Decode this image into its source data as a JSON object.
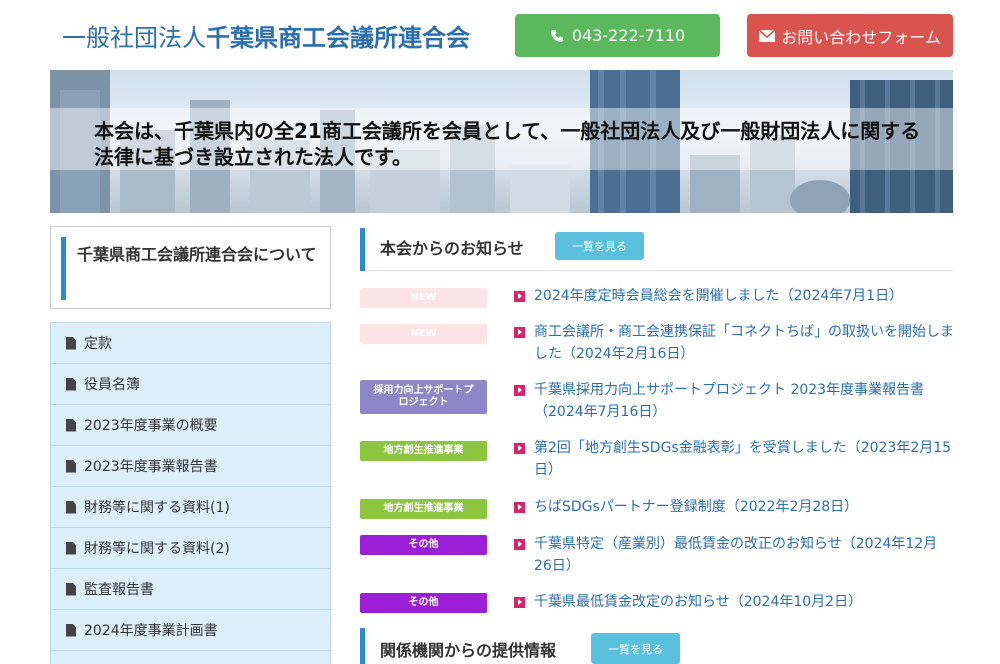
{
  "header": {
    "title_prefix": "一般社団法人",
    "title_main": "千葉県商工会議所連合会",
    "phone_label": "043-222-7110",
    "contact_label": "お問い合わせフォーム"
  },
  "hero": {
    "text": "本会は、千葉県内の全21商工会議所を会員として、一般社団法人及び一般財団法人に関する法律に基づき設立された法人です。"
  },
  "sidebar": {
    "heading": "千葉県商工会議所連合会について",
    "items": [
      "定款",
      "役員名簿",
      "2023年度事業の概要",
      "2023年度事業報告書",
      "財務等に関する資料(1)",
      "財務等に関する資料(2)",
      "監査報告書",
      "2024年度事業計画書"
    ]
  },
  "news": {
    "heading": "本会からのお知らせ",
    "list_button": "一覧を見る",
    "items": [
      {
        "tag": "NEW",
        "text": "2024年度定時会員総会を開催しました（2024年7月1日）"
      },
      {
        "tag": "NEW",
        "text": "商工会議所・商工会連携保証「コネクトちば」の取扱いを開始しました（2024年2月16日）"
      },
      {
        "tag": "採用力向上サポートプロジェクト",
        "text": "千葉県採用力向上サポートプロジェクト 2023年度事業報告書（2024年7月16日）"
      },
      {
        "tag": "地方創生推進事業",
        "text": "第2回「地方創生SDGs金融表彰」を受賞しました（2023年2月15日）"
      },
      {
        "tag": "地方創生推進事業",
        "text": "ちばSDGsパートナー登録制度（2022年2月28日）"
      },
      {
        "tag": "その他",
        "text": "千葉県特定（産業別）最低賃金の改正のお知らせ（2024年12月26日）"
      },
      {
        "tag": "その他",
        "text": "千葉県最低賃金改定のお知らせ（2024年10月2日）"
      }
    ]
  },
  "related": {
    "heading": "関係機関からの提供情報",
    "list_button": "一覧を見る"
  },
  "colors": {
    "accent_blue": "#2d8ad6",
    "phone_green": "#5cb85c",
    "contact_red": "#d9534f",
    "link_blue": "#2a6fb0"
  }
}
